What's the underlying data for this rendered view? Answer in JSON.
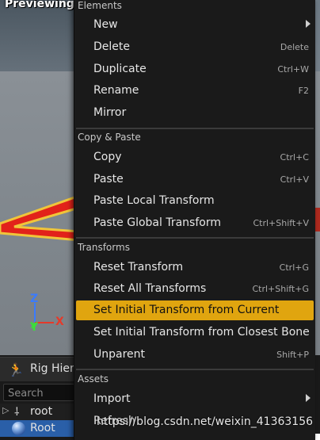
{
  "viewport": {
    "title": "Previewing R",
    "axis": {
      "z": "Z",
      "x": "X",
      "y": "Y"
    }
  },
  "rig_panel": {
    "tab_label": "Rig Hier",
    "search_placeholder": "Search",
    "tree": [
      {
        "label": "root"
      },
      {
        "label": "Root"
      }
    ]
  },
  "menu": {
    "sections": [
      {
        "header": "Elements"
      },
      {
        "header": "Copy & Paste"
      },
      {
        "header": "Transforms"
      },
      {
        "header": "Assets"
      }
    ],
    "items": {
      "new": {
        "label": "New",
        "shortcut": ""
      },
      "delete": {
        "label": "Delete",
        "shortcut": "Delete"
      },
      "duplicate": {
        "label": "Duplicate",
        "shortcut": "Ctrl+W"
      },
      "rename": {
        "label": "Rename",
        "shortcut": "F2"
      },
      "mirror": {
        "label": "Mirror",
        "shortcut": ""
      },
      "copy": {
        "label": "Copy",
        "shortcut": "Ctrl+C"
      },
      "paste": {
        "label": "Paste",
        "shortcut": "Ctrl+V"
      },
      "paste_local": {
        "label": "Paste Local Transform",
        "shortcut": ""
      },
      "paste_global": {
        "label": "Paste Global Transform",
        "shortcut": "Ctrl+Shift+V"
      },
      "reset": {
        "label": "Reset Transform",
        "shortcut": "Ctrl+G"
      },
      "reset_all": {
        "label": "Reset All Transforms",
        "shortcut": "Ctrl+Shift+G"
      },
      "set_initial_current": {
        "label": "Set Initial Transform from Current",
        "shortcut": ""
      },
      "set_initial_bone": {
        "label": "Set Initial Transform from Closest Bone",
        "shortcut": ""
      },
      "unparent": {
        "label": "Unparent",
        "shortcut": "Shift+P"
      },
      "import": {
        "label": "Import",
        "shortcut": ""
      },
      "refresh": {
        "label": "Refresh",
        "shortcut": ""
      }
    },
    "highlight_color": "#e0a50f"
  },
  "watermark": "https://blog.csdn.net/weixin_41363156",
  "colors": {
    "axis_z": "#3a7bff",
    "axis_x": "#e53a2a",
    "axis_y": "#3adf3a",
    "selection_blue": "#2a5fa8"
  }
}
